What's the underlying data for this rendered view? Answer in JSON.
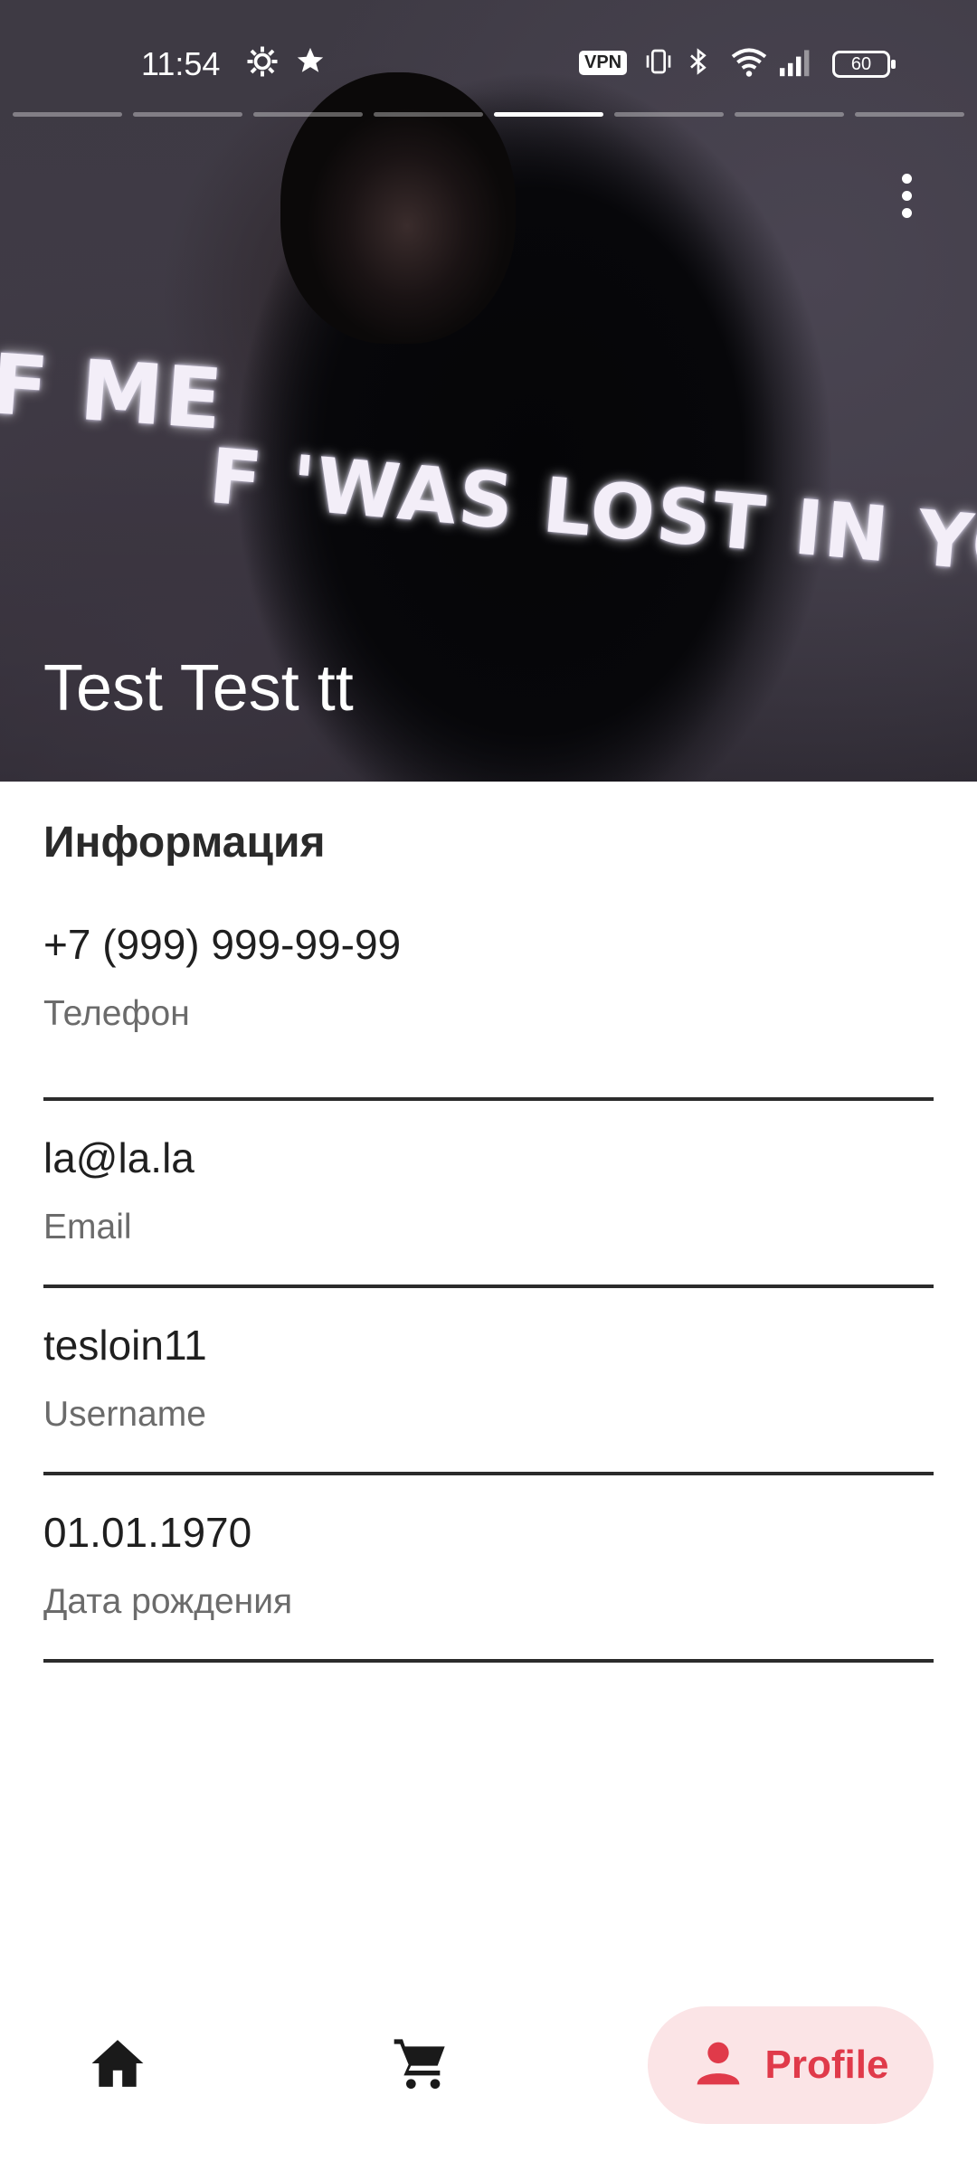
{
  "status_bar": {
    "time": "11:54",
    "icons": [
      "settings-gear-icon",
      "star-icon",
      "vpn-icon",
      "vibrate-icon",
      "bluetooth-icon",
      "wifi-icon",
      "signal-icon",
      "battery-icon"
    ],
    "vpn_label": "VPN",
    "battery_level": "60"
  },
  "story": {
    "segment_count": 8,
    "active_segment": 5,
    "photo_caption_text": [
      "F ME",
      "F 'WAS LOST IN YOU"
    ]
  },
  "profile": {
    "name": "Test Test tt"
  },
  "info": {
    "title": "Информация",
    "items": [
      {
        "value": "+7 (999) 999-99-99",
        "label": "Телефон"
      },
      {
        "value": "la@la.la",
        "label": "Email"
      },
      {
        "value": "tesloin11",
        "label": "Username"
      },
      {
        "value": "01.01.1970",
        "label": "Дата рождения"
      }
    ]
  },
  "bottom_nav": {
    "profile_label": "Profile",
    "accent_color": "#e03a4a",
    "active_bg": "#fbe4e6"
  }
}
